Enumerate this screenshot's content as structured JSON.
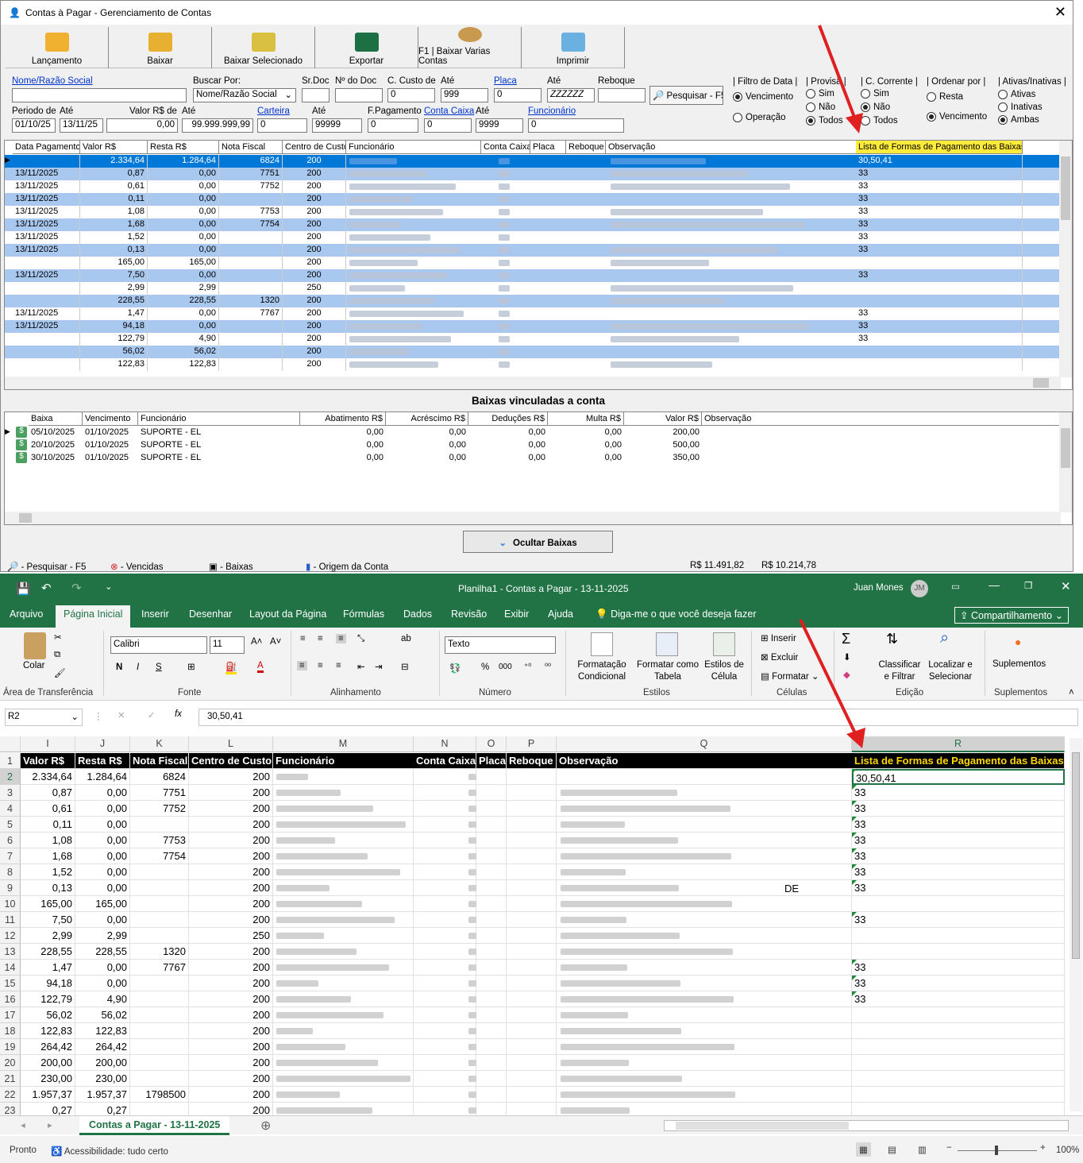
{
  "app": {
    "title": "Contas à Pagar - Gerenciamento de Contas",
    "toolbar": [
      "Lançamento",
      "Baixar",
      "Baixar Selecionado",
      "Exportar",
      "F1 | Baixar Varias Contas",
      "Imprimir"
    ]
  },
  "filters": {
    "nome_label": "Nome/Razão Social",
    "buscar_label": "Buscar Por:",
    "buscar_value": "Nome/Razão Social",
    "srdoc_label": "Sr.Doc",
    "ndoc_label": "Nº do Doc",
    "ccusto_label": "C. Custo de",
    "ccusto_value": "0",
    "ate_label": "Até",
    "ccusto_ate": "999",
    "placa_label": "Placa",
    "placa_value": "0",
    "placa_ate": "ZZZZZZ",
    "reboque_label": "Reboque",
    "pesquisar": "Pesquisar - F5",
    "periodo_label": "Periodo de",
    "periodo_de": "01/10/25",
    "periodo_ate": "13/11/25",
    "valor_label": "Valor R$ de",
    "valor_de": "0,00",
    "valor_ate": "99.999.999,99",
    "carteira_label": "Carteira",
    "carteira_value": "0",
    "carteira_ate": "99999",
    "fpag_label": "F.Pagamento",
    "fpag_value": "0",
    "contacaixa_label": "Conta Caixa",
    "contacaixa_value": "0",
    "contacaixa_ate": "9999",
    "funcionario_label": "Funcionário",
    "funcionario_value": "0",
    "filtro_data": "| Filtro de Data |",
    "vencimento": "Vencimento",
    "operacao": "Operação",
    "provisao": "| Provisã |",
    "sim": "Sim",
    "nao": "Não",
    "todos": "Todos",
    "ccorrente": "| C. Corrente |",
    "ordenar": "| Ordenar por |",
    "resta": "Resta",
    "ativas_label": "| Ativas/Inativas |",
    "ativas": "Ativas",
    "inativas": "Inativas",
    "ambas": "Ambas"
  },
  "grid": {
    "headers": [
      "Data Pagamento",
      "Valor R$",
      "Resta R$",
      "Nota Fiscal",
      "Centro de Custo",
      "Funcionário",
      "Conta Caixa",
      "Placa",
      "Reboque",
      "Observação",
      "Lista de Formas de Pagamento das Baixas"
    ],
    "rows": [
      [
        "",
        "2.334,64",
        "1.284,64",
        "6824",
        "200",
        "30,50,41"
      ],
      [
        "13/11/2025",
        "0,87",
        "0,00",
        "7751",
        "200",
        "33"
      ],
      [
        "13/11/2025",
        "0,61",
        "0,00",
        "7752",
        "200",
        "33"
      ],
      [
        "13/11/2025",
        "0,11",
        "0,00",
        "",
        "200",
        "33"
      ],
      [
        "13/11/2025",
        "1,08",
        "0,00",
        "7753",
        "200",
        "33"
      ],
      [
        "13/11/2025",
        "1,68",
        "0,00",
        "7754",
        "200",
        "33"
      ],
      [
        "13/11/2025",
        "1,52",
        "0,00",
        "",
        "200",
        "33"
      ],
      [
        "13/11/2025",
        "0,13",
        "0,00",
        "",
        "200",
        "33"
      ],
      [
        "",
        "165,00",
        "165,00",
        "",
        "200",
        ""
      ],
      [
        "13/11/2025",
        "7,50",
        "0,00",
        "",
        "200",
        "33"
      ],
      [
        "",
        "2,99",
        "2,99",
        "",
        "250",
        ""
      ],
      [
        "",
        "228,55",
        "228,55",
        "1320",
        "200",
        ""
      ],
      [
        "13/11/2025",
        "1,47",
        "0,00",
        "7767",
        "200",
        "33"
      ],
      [
        "13/11/2025",
        "94,18",
        "0,00",
        "",
        "200",
        "33"
      ],
      [
        "",
        "122,79",
        "4,90",
        "",
        "200",
        "33"
      ],
      [
        "",
        "56,02",
        "56,02",
        "",
        "200",
        ""
      ],
      [
        "",
        "122,83",
        "122,83",
        "",
        "200",
        ""
      ]
    ]
  },
  "baixas": {
    "title": "Baixas vinculadas a conta",
    "headers": [
      "Baixa",
      "Vencimento",
      "Funcionário",
      "Abatimento R$",
      "Acréscimo R$",
      "Deduções R$",
      "Multa R$",
      "Valor R$",
      "Observação"
    ],
    "rows": [
      [
        "05/10/2025",
        "01/10/2025",
        "SUPORTE - EL",
        "0,00",
        "0,00",
        "0,00",
        "0,00",
        "200,00"
      ],
      [
        "20/10/2025",
        "01/10/2025",
        "SUPORTE - EL",
        "0,00",
        "0,00",
        "0,00",
        "0,00",
        "500,00"
      ],
      [
        "30/10/2025",
        "01/10/2025",
        "SUPORTE - EL",
        "0,00",
        "0,00",
        "0,00",
        "0,00",
        "350,00"
      ]
    ],
    "ocultar": "Ocultar Baixas"
  },
  "status": {
    "pesquisar": "- Pesquisar - F5",
    "vencidas": "- Vencidas",
    "baixas": "- Baixas",
    "origem": "- Origem da Conta",
    "total1": "R$ 11.491,82",
    "total2": "R$ 10.214,78"
  },
  "excel": {
    "title": "Planilha1  -  Contas a Pagar - 13-11-2025",
    "user": "Juan Mones",
    "initials": "JM",
    "tabs": [
      "Arquivo",
      "Página Inicial",
      "Inserir",
      "Desenhar",
      "Layout da Página",
      "Fórmulas",
      "Dados",
      "Revisão",
      "Exibir",
      "Ajuda"
    ],
    "tell": "Diga-me o que você deseja fazer",
    "share": "Compartilhamento",
    "ribbon": {
      "colar": "Colar",
      "clip": "Área de Transferência",
      "font": "Calibri",
      "size": "11",
      "fonte": "Fonte",
      "alinhamento": "Alinhamento",
      "numfmt": "Texto",
      "numero": "Número",
      "fc": "Formatação Condicional",
      "ft": "Formatar como Tabela",
      "ec": "Estilos de Célula",
      "estilos": "Estilos",
      "inserir": "Inserir",
      "excluir": "Excluir",
      "formatar": "Formatar",
      "celulas": "Células",
      "classificar": "Classificar e Filtrar",
      "localizar": "Localizar e Selecionar",
      "edicao": "Edição",
      "suplementos": "Suplementos"
    },
    "namebox": "R2",
    "formula": "30,50,41",
    "columns": [
      "I",
      "J",
      "K",
      "L",
      "M",
      "N",
      "O",
      "P",
      "Q",
      "R"
    ],
    "header_row": [
      "Valor R$",
      "Resta R$",
      "Nota Fiscal",
      "Centro de Custo",
      "Funcionário",
      "Conta Caixa",
      "Placa",
      "Reboque",
      "Observação",
      "Lista de Formas de Pagamento das Baixas"
    ],
    "rows": [
      [
        "2.334,64",
        "1.284,64",
        "6824",
        "200",
        "30,50,41"
      ],
      [
        "0,87",
        "0,00",
        "7751",
        "200",
        "33"
      ],
      [
        "0,61",
        "0,00",
        "7752",
        "200",
        "33"
      ],
      [
        "0,11",
        "0,00",
        "",
        "200",
        "33"
      ],
      [
        "1,08",
        "0,00",
        "7753",
        "200",
        "33"
      ],
      [
        "1,68",
        "0,00",
        "7754",
        "200",
        "33"
      ],
      [
        "1,52",
        "0,00",
        "",
        "200",
        "33"
      ],
      [
        "0,13",
        "0,00",
        "",
        "200",
        "33"
      ],
      [
        "165,00",
        "165,00",
        "",
        "200",
        ""
      ],
      [
        "7,50",
        "0,00",
        "",
        "200",
        "33"
      ],
      [
        "2,99",
        "2,99",
        "",
        "250",
        ""
      ],
      [
        "228,55",
        "228,55",
        "1320",
        "200",
        ""
      ],
      [
        "1,47",
        "0,00",
        "7767",
        "200",
        "33"
      ],
      [
        "94,18",
        "0,00",
        "",
        "200",
        "33"
      ],
      [
        "122,79",
        "4,90",
        "",
        "200",
        "33"
      ],
      [
        "56,02",
        "56,02",
        "",
        "200",
        ""
      ],
      [
        "122,83",
        "122,83",
        "",
        "200",
        ""
      ],
      [
        "264,42",
        "264,42",
        "",
        "200",
        ""
      ],
      [
        "200,00",
        "200,00",
        "",
        "200",
        ""
      ],
      [
        "230,00",
        "230,00",
        "",
        "200",
        ""
      ],
      [
        "1.957,37",
        "1.957,37",
        "1798500",
        "200",
        ""
      ],
      [
        "0,27",
        "0,27",
        "",
        "200",
        ""
      ]
    ],
    "obs_fragment": "DE",
    "sheet": "Contas a Pagar - 13-11-2025",
    "status_ready": "Pronto",
    "accessibility": "Acessibilidade: tudo certo",
    "zoom": "100%"
  },
  "colors": {
    "excel_green": "#217346",
    "selection": "#0078d7",
    "row_alt": "#a9c8ef",
    "header_yellow": "#ffeb3b",
    "arrow": "#e02020"
  }
}
